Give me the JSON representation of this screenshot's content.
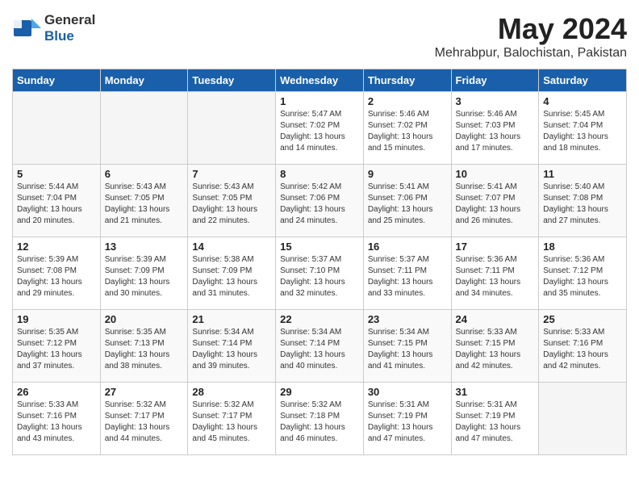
{
  "header": {
    "logo_general": "General",
    "logo_blue": "Blue",
    "month_year": "May 2024",
    "location": "Mehrabpur, Balochistan, Pakistan"
  },
  "days_of_week": [
    "Sunday",
    "Monday",
    "Tuesday",
    "Wednesday",
    "Thursday",
    "Friday",
    "Saturday"
  ],
  "weeks": [
    [
      {
        "day": "",
        "empty": true
      },
      {
        "day": "",
        "empty": true
      },
      {
        "day": "",
        "empty": true
      },
      {
        "day": "1",
        "sunrise": "5:47 AM",
        "sunset": "7:02 PM",
        "daylight": "13 hours and 14 minutes."
      },
      {
        "day": "2",
        "sunrise": "5:46 AM",
        "sunset": "7:02 PM",
        "daylight": "13 hours and 15 minutes."
      },
      {
        "day": "3",
        "sunrise": "5:46 AM",
        "sunset": "7:03 PM",
        "daylight": "13 hours and 17 minutes."
      },
      {
        "day": "4",
        "sunrise": "5:45 AM",
        "sunset": "7:04 PM",
        "daylight": "13 hours and 18 minutes."
      }
    ],
    [
      {
        "day": "5",
        "sunrise": "5:44 AM",
        "sunset": "7:04 PM",
        "daylight": "13 hours and 20 minutes."
      },
      {
        "day": "6",
        "sunrise": "5:43 AM",
        "sunset": "7:05 PM",
        "daylight": "13 hours and 21 minutes."
      },
      {
        "day": "7",
        "sunrise": "5:43 AM",
        "sunset": "7:05 PM",
        "daylight": "13 hours and 22 minutes."
      },
      {
        "day": "8",
        "sunrise": "5:42 AM",
        "sunset": "7:06 PM",
        "daylight": "13 hours and 24 minutes."
      },
      {
        "day": "9",
        "sunrise": "5:41 AM",
        "sunset": "7:06 PM",
        "daylight": "13 hours and 25 minutes."
      },
      {
        "day": "10",
        "sunrise": "5:41 AM",
        "sunset": "7:07 PM",
        "daylight": "13 hours and 26 minutes."
      },
      {
        "day": "11",
        "sunrise": "5:40 AM",
        "sunset": "7:08 PM",
        "daylight": "13 hours and 27 minutes."
      }
    ],
    [
      {
        "day": "12",
        "sunrise": "5:39 AM",
        "sunset": "7:08 PM",
        "daylight": "13 hours and 29 minutes."
      },
      {
        "day": "13",
        "sunrise": "5:39 AM",
        "sunset": "7:09 PM",
        "daylight": "13 hours and 30 minutes."
      },
      {
        "day": "14",
        "sunrise": "5:38 AM",
        "sunset": "7:09 PM",
        "daylight": "13 hours and 31 minutes."
      },
      {
        "day": "15",
        "sunrise": "5:37 AM",
        "sunset": "7:10 PM",
        "daylight": "13 hours and 32 minutes."
      },
      {
        "day": "16",
        "sunrise": "5:37 AM",
        "sunset": "7:11 PM",
        "daylight": "13 hours and 33 minutes."
      },
      {
        "day": "17",
        "sunrise": "5:36 AM",
        "sunset": "7:11 PM",
        "daylight": "13 hours and 34 minutes."
      },
      {
        "day": "18",
        "sunrise": "5:36 AM",
        "sunset": "7:12 PM",
        "daylight": "13 hours and 35 minutes."
      }
    ],
    [
      {
        "day": "19",
        "sunrise": "5:35 AM",
        "sunset": "7:12 PM",
        "daylight": "13 hours and 37 minutes."
      },
      {
        "day": "20",
        "sunrise": "5:35 AM",
        "sunset": "7:13 PM",
        "daylight": "13 hours and 38 minutes."
      },
      {
        "day": "21",
        "sunrise": "5:34 AM",
        "sunset": "7:14 PM",
        "daylight": "13 hours and 39 minutes."
      },
      {
        "day": "22",
        "sunrise": "5:34 AM",
        "sunset": "7:14 PM",
        "daylight": "13 hours and 40 minutes."
      },
      {
        "day": "23",
        "sunrise": "5:34 AM",
        "sunset": "7:15 PM",
        "daylight": "13 hours and 41 minutes."
      },
      {
        "day": "24",
        "sunrise": "5:33 AM",
        "sunset": "7:15 PM",
        "daylight": "13 hours and 42 minutes."
      },
      {
        "day": "25",
        "sunrise": "5:33 AM",
        "sunset": "7:16 PM",
        "daylight": "13 hours and 42 minutes."
      }
    ],
    [
      {
        "day": "26",
        "sunrise": "5:33 AM",
        "sunset": "7:16 PM",
        "daylight": "13 hours and 43 minutes."
      },
      {
        "day": "27",
        "sunrise": "5:32 AM",
        "sunset": "7:17 PM",
        "daylight": "13 hours and 44 minutes."
      },
      {
        "day": "28",
        "sunrise": "5:32 AM",
        "sunset": "7:17 PM",
        "daylight": "13 hours and 45 minutes."
      },
      {
        "day": "29",
        "sunrise": "5:32 AM",
        "sunset": "7:18 PM",
        "daylight": "13 hours and 46 minutes."
      },
      {
        "day": "30",
        "sunrise": "5:31 AM",
        "sunset": "7:19 PM",
        "daylight": "13 hours and 47 minutes."
      },
      {
        "day": "31",
        "sunrise": "5:31 AM",
        "sunset": "7:19 PM",
        "daylight": "13 hours and 47 minutes."
      },
      {
        "day": "",
        "empty": true
      }
    ]
  ]
}
